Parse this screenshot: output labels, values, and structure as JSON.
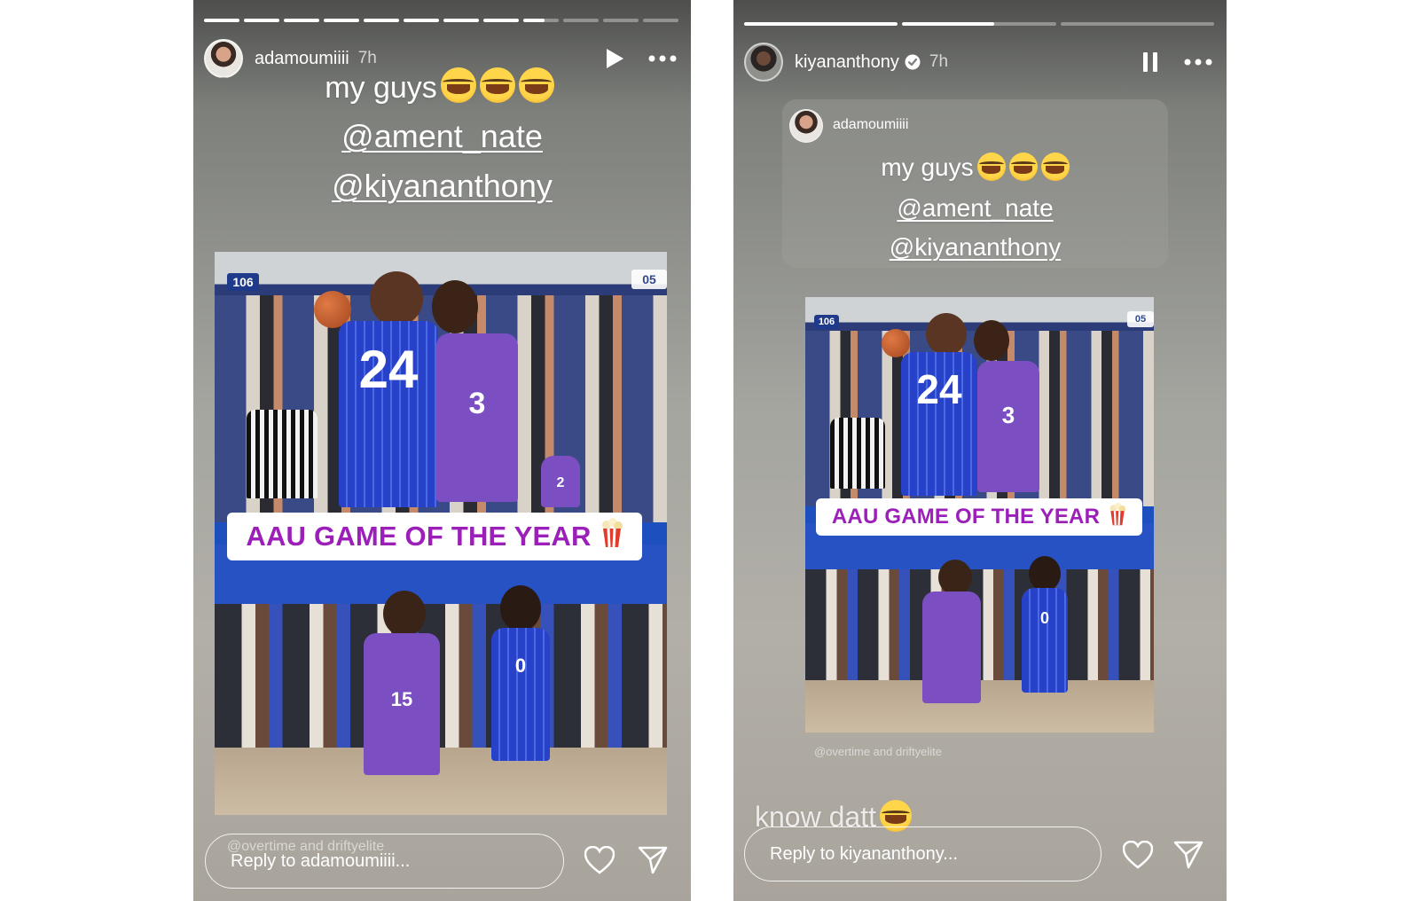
{
  "left_story": {
    "progress": [
      1,
      1,
      1,
      1,
      1,
      1,
      1,
      1,
      0.6,
      0,
      0,
      0
    ],
    "header": {
      "username": "adamoumiiii",
      "time": "7h",
      "play_icon": "play-icon",
      "more_icon": "more-icon"
    },
    "caption": {
      "text": "my guys",
      "mention_1": "@ament_nate",
      "mention_2": "@kiyananthony"
    },
    "photo": {
      "banner_text": "AAU GAME OF THE YEAR",
      "scoreboard": "106",
      "corner_tag": "05",
      "jersey_a": "24",
      "jersey_b": "3",
      "jersey_c": "2",
      "jersey_d": "15",
      "jersey_e": "0"
    },
    "credit": "@overtime and driftyelite",
    "footer": {
      "reply_placeholder": "Reply to adamoumiiii...",
      "like_icon": "heart-icon",
      "share_icon": "send-icon"
    }
  },
  "right_story": {
    "progress": [
      1,
      0.6,
      0
    ],
    "header": {
      "username": "kiyananthony",
      "verified_icon": "verified-badge-icon",
      "time": "7h",
      "pause_icon": "pause-icon",
      "more_icon": "more-icon"
    },
    "quoted": {
      "username": "adamoumiiii",
      "caption": {
        "text": "my guys",
        "mention_1": "@ament_nate",
        "mention_2": "@kiyananthony"
      }
    },
    "photo": {
      "banner_text": "AAU GAME OF THE YEAR",
      "scoreboard": "106",
      "corner_tag": "05",
      "jersey_a": "24",
      "jersey_b": "3",
      "jersey_e": "0"
    },
    "credit": "@overtime and driftyelite",
    "caption_bottom": "know datt",
    "footer": {
      "reply_placeholder": "Reply to kiyananthony...",
      "like_icon": "heart-icon",
      "share_icon": "send-icon"
    }
  }
}
